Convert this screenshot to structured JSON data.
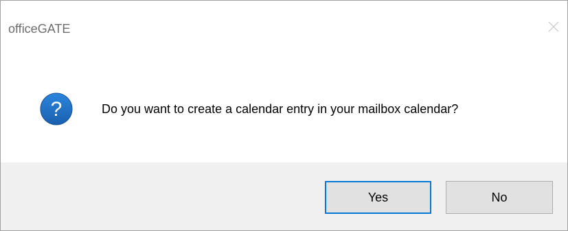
{
  "dialog": {
    "title": "officeGATE",
    "message": "Do you want to create a calendar entry in your mailbox calendar?",
    "icon": "question-icon",
    "buttons": {
      "yes_label": "Yes",
      "no_label": "No"
    },
    "close_icon": "close-icon"
  },
  "colors": {
    "icon_blue": "#1f6fc5",
    "focus_border": "#0078d7",
    "footer_bg": "#f0f0f0",
    "button_bg": "#e1e1e1"
  }
}
